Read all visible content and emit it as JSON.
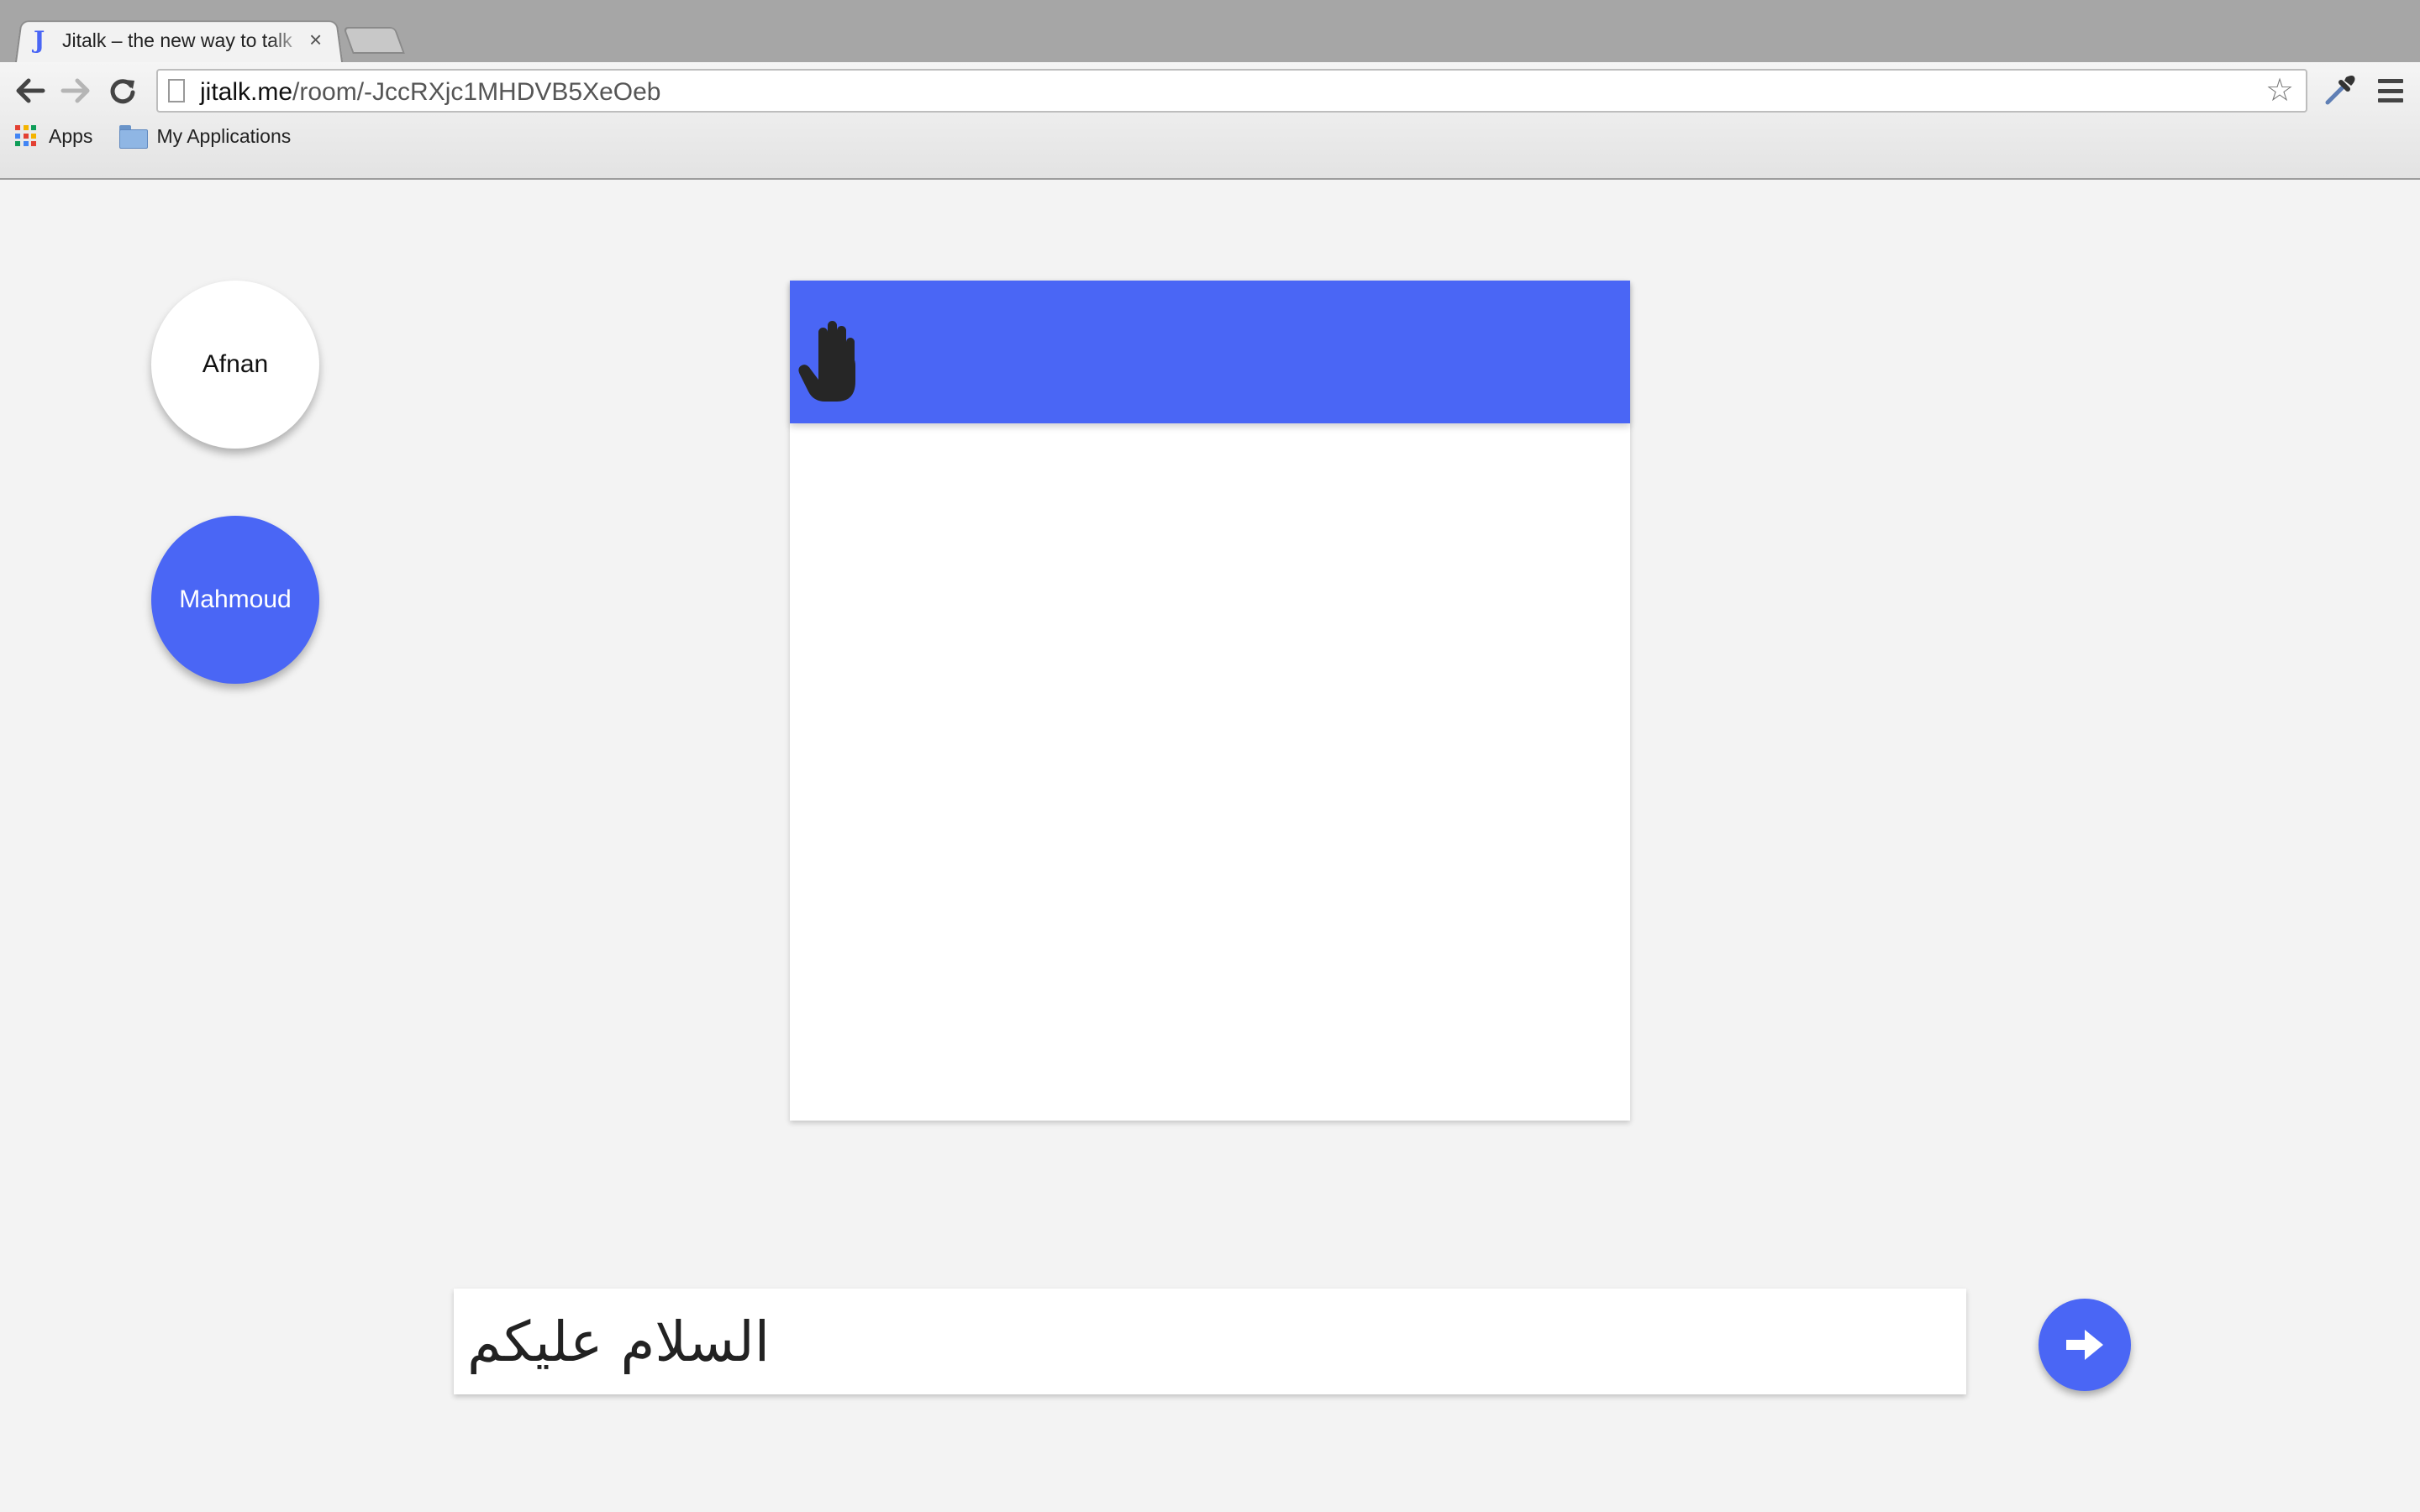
{
  "browser": {
    "tab": {
      "favicon": "J",
      "title": "Jitalk – the new way to talk",
      "close_glyph": "×"
    },
    "omnibox": {
      "host": "jitalk.me",
      "path": "/room/-JccRXjc1MHDVB5XeOeb"
    },
    "bookmarks": {
      "apps_label": "Apps",
      "folder_label": "My Applications"
    },
    "icons": {
      "back": "back-arrow-icon",
      "forward": "forward-arrow-icon",
      "reload": "reload-icon",
      "bookmark": "star-icon",
      "extension": "eyedropper-icon",
      "menu": "hamburger-menu-icon"
    }
  },
  "colors": {
    "accent": "#4a66f5",
    "page_bg": "#f3f3f3",
    "hand": "#262626"
  },
  "users": [
    {
      "name": "Afnan",
      "active": false
    },
    {
      "name": "Mahmoud",
      "active": true
    }
  ],
  "chat": {
    "header_icon": "raised-hand-icon"
  },
  "composer": {
    "message_value": "السلام عليكم",
    "send_icon": "arrow-right-icon"
  }
}
